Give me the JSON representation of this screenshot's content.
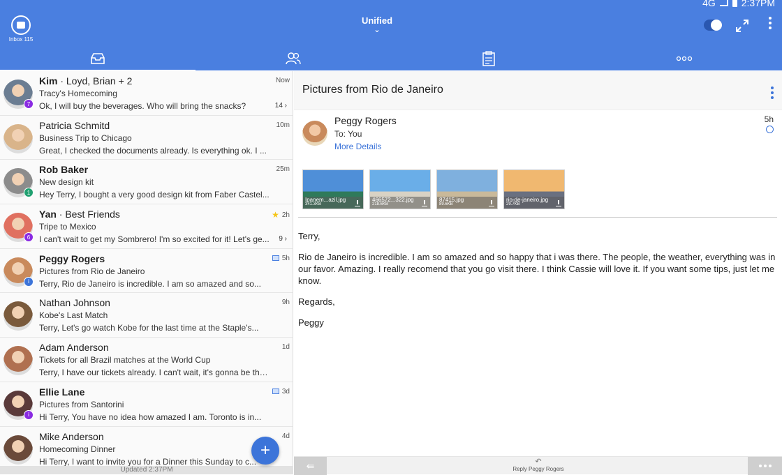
{
  "status": {
    "network": "4G",
    "time": "2:37PM"
  },
  "header": {
    "inbox_label": "Inbox 115",
    "title": "Unified",
    "chevron": "⌄"
  },
  "tabs": [
    {
      "icon": "inbox-tray-icon"
    },
    {
      "icon": "contacts-icon"
    },
    {
      "icon": "clipboard-icon"
    },
    {
      "icon": "more-horizontal-icon"
    }
  ],
  "messages": [
    {
      "sender": "Kim",
      "group": "· Loyd, Brian + 2",
      "subject": "Tracy's Homecoming",
      "preview": "Ok, I will buy the beverages. Who will bring the snacks?",
      "time": "Now",
      "count": "14 ›",
      "badge": "7",
      "badge_color": "#8a2be2",
      "unread": true,
      "star": false,
      "image": false,
      "avatar_color": "#6b7d92"
    },
    {
      "sender": "Patricia Schmitd",
      "group": "",
      "subject": "Business Trip to Chicago",
      "preview": "Great, I checked the documents already. Is everything ok. I ...",
      "time": "10m",
      "count": "",
      "badge": "",
      "badge_color": "",
      "unread": false,
      "star": false,
      "image": false,
      "avatar_color": "#d9b48a"
    },
    {
      "sender": "Rob Baker",
      "group": "",
      "subject": "New design kit",
      "preview": "Hey Terry, I bought a very good design kit from Faber Castel...",
      "time": "25m",
      "count": "",
      "badge": "1",
      "badge_color": "#20a070",
      "unread": true,
      "star": false,
      "image": false,
      "avatar_color": "#8c8c8c"
    },
    {
      "sender": "Yan",
      "group": "· Best Friends",
      "subject": "Tripe to Mexico",
      "preview": "I can't wait to get my Sombrero! I'm so excited for it! Let's ge...",
      "time": "2h",
      "count": "9 ›",
      "badge": "6",
      "badge_color": "#8a2be2",
      "unread": true,
      "star": true,
      "image": false,
      "avatar_color": "#e07060"
    },
    {
      "sender": "Peggy Rogers",
      "group": "",
      "subject": "Pictures from Rio de Janeiro",
      "preview": "Terry, Rio de Janeiro is incredible. I am so amazed and so...",
      "time": "5h",
      "count": "",
      "badge": "i",
      "badge_color": "#3c74d9",
      "unread": true,
      "star": false,
      "image": true,
      "avatar_color": "#c98a5c"
    },
    {
      "sender": "Nathan Johnson",
      "group": "",
      "subject": "Kobe's Last Match",
      "preview": "Terry, Let's go watch Kobe for the last time at the Staple's...",
      "time": "9h",
      "count": "",
      "badge": "",
      "badge_color": "",
      "unread": false,
      "star": false,
      "image": false,
      "avatar_color": "#7a5a3c"
    },
    {
      "sender": "Adam Anderson",
      "group": "",
      "subject": "Tickets for all Brazil matches at the World Cup",
      "preview": "Terry, I have our tickets already. I can't wait, it's gonna be the...",
      "time": "1d",
      "count": "",
      "badge": "",
      "badge_color": "",
      "unread": false,
      "star": false,
      "image": false,
      "avatar_color": "#b07050"
    },
    {
      "sender": "Ellie Lane",
      "group": "",
      "subject": "Pictures from Santorini",
      "preview": "Hi Terry, You have no idea how amazed I am. Toronto is in...",
      "time": "3d",
      "count": "",
      "badge": "i",
      "badge_color": "#8a2be2",
      "unread": true,
      "star": false,
      "image": true,
      "avatar_color": "#5a3a3a"
    },
    {
      "sender": "Mike Anderson",
      "group": "",
      "subject": "Homecoming Dinner",
      "preview": "Hi Terry, I want to invite you for a Dinner this Sunday to c...",
      "time": "4d",
      "count": "",
      "badge": "",
      "badge_color": "",
      "unread": false,
      "star": false,
      "image": false,
      "avatar_color": "#6a4a3a"
    }
  ],
  "fab_label": "+",
  "updated": "Updated 2:37PM",
  "detail": {
    "subject": "Pictures from Rio de Janeiro",
    "from_name": "Peggy Rogers",
    "to": "To: You",
    "more_details": "More Details",
    "time": "5h",
    "attachments": [
      {
        "name": "Ipanem...azil.jpg",
        "size": "341.3KB",
        "sky": "#4f8fd8",
        "ground": "#2f7a5a"
      },
      {
        "name": "466572...322.jpg",
        "size": "218.6KB",
        "sky": "#6aaee8",
        "ground": "#d8d2c4"
      },
      {
        "name": "87415.jpg",
        "size": "89.6KB",
        "sky": "#7fb0de",
        "ground": "#c9b99a"
      },
      {
        "name": "rio-de-janeiro.jpg",
        "size": "29.7KB",
        "sky": "#f0b870",
        "ground": "#6a7080"
      }
    ],
    "body": [
      "Terry,",
      "Rio de Janeiro is incredible. I am so amazed and so happy that i was there. The people, the weather, everything was in our favor. Amazing. I really recomend that you go visit there. I think Cassie will love it. If you want some tips, just let me know.",
      "Regards,",
      "Peggy"
    ],
    "reply_label": "Reply Peggy Rogers"
  }
}
